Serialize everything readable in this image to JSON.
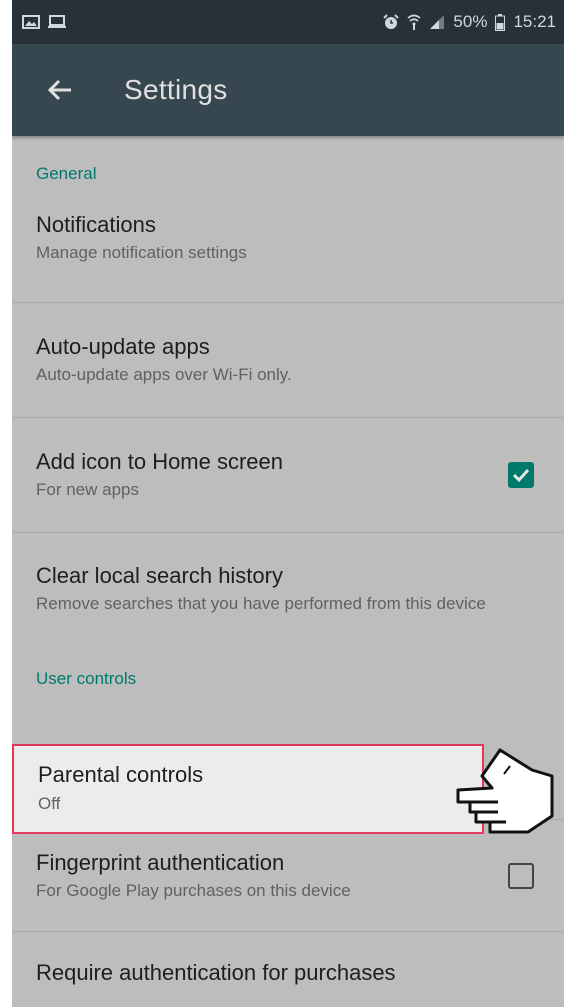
{
  "status_bar": {
    "battery": "50%",
    "time": "15:21"
  },
  "toolbar": {
    "title": "Settings",
    "back_icon": "arrow-left-icon"
  },
  "sections": {
    "general": {
      "header": "General",
      "items": [
        {
          "title": "Notifications",
          "subtitle": "Manage notification settings"
        },
        {
          "title": "Auto-update apps",
          "subtitle": "Auto-update apps over Wi-Fi only."
        },
        {
          "title": "Add icon to Home screen",
          "subtitle": "For new apps",
          "checked": true
        },
        {
          "title": "Clear local search history",
          "subtitle": "Remove searches that you have performed from this device"
        }
      ]
    },
    "user_controls": {
      "header": "User controls",
      "items": [
        {
          "title": "Parental controls",
          "subtitle": "Off"
        },
        {
          "title": "Fingerprint authentication",
          "subtitle": "For Google Play purchases on this device",
          "checked": false
        },
        {
          "title": "Require authentication for purchases"
        }
      ]
    }
  },
  "colors": {
    "accent": "#00796b",
    "toolbar": "#37474f",
    "status_bar": "#263238",
    "highlight_border": "#e5365e"
  }
}
